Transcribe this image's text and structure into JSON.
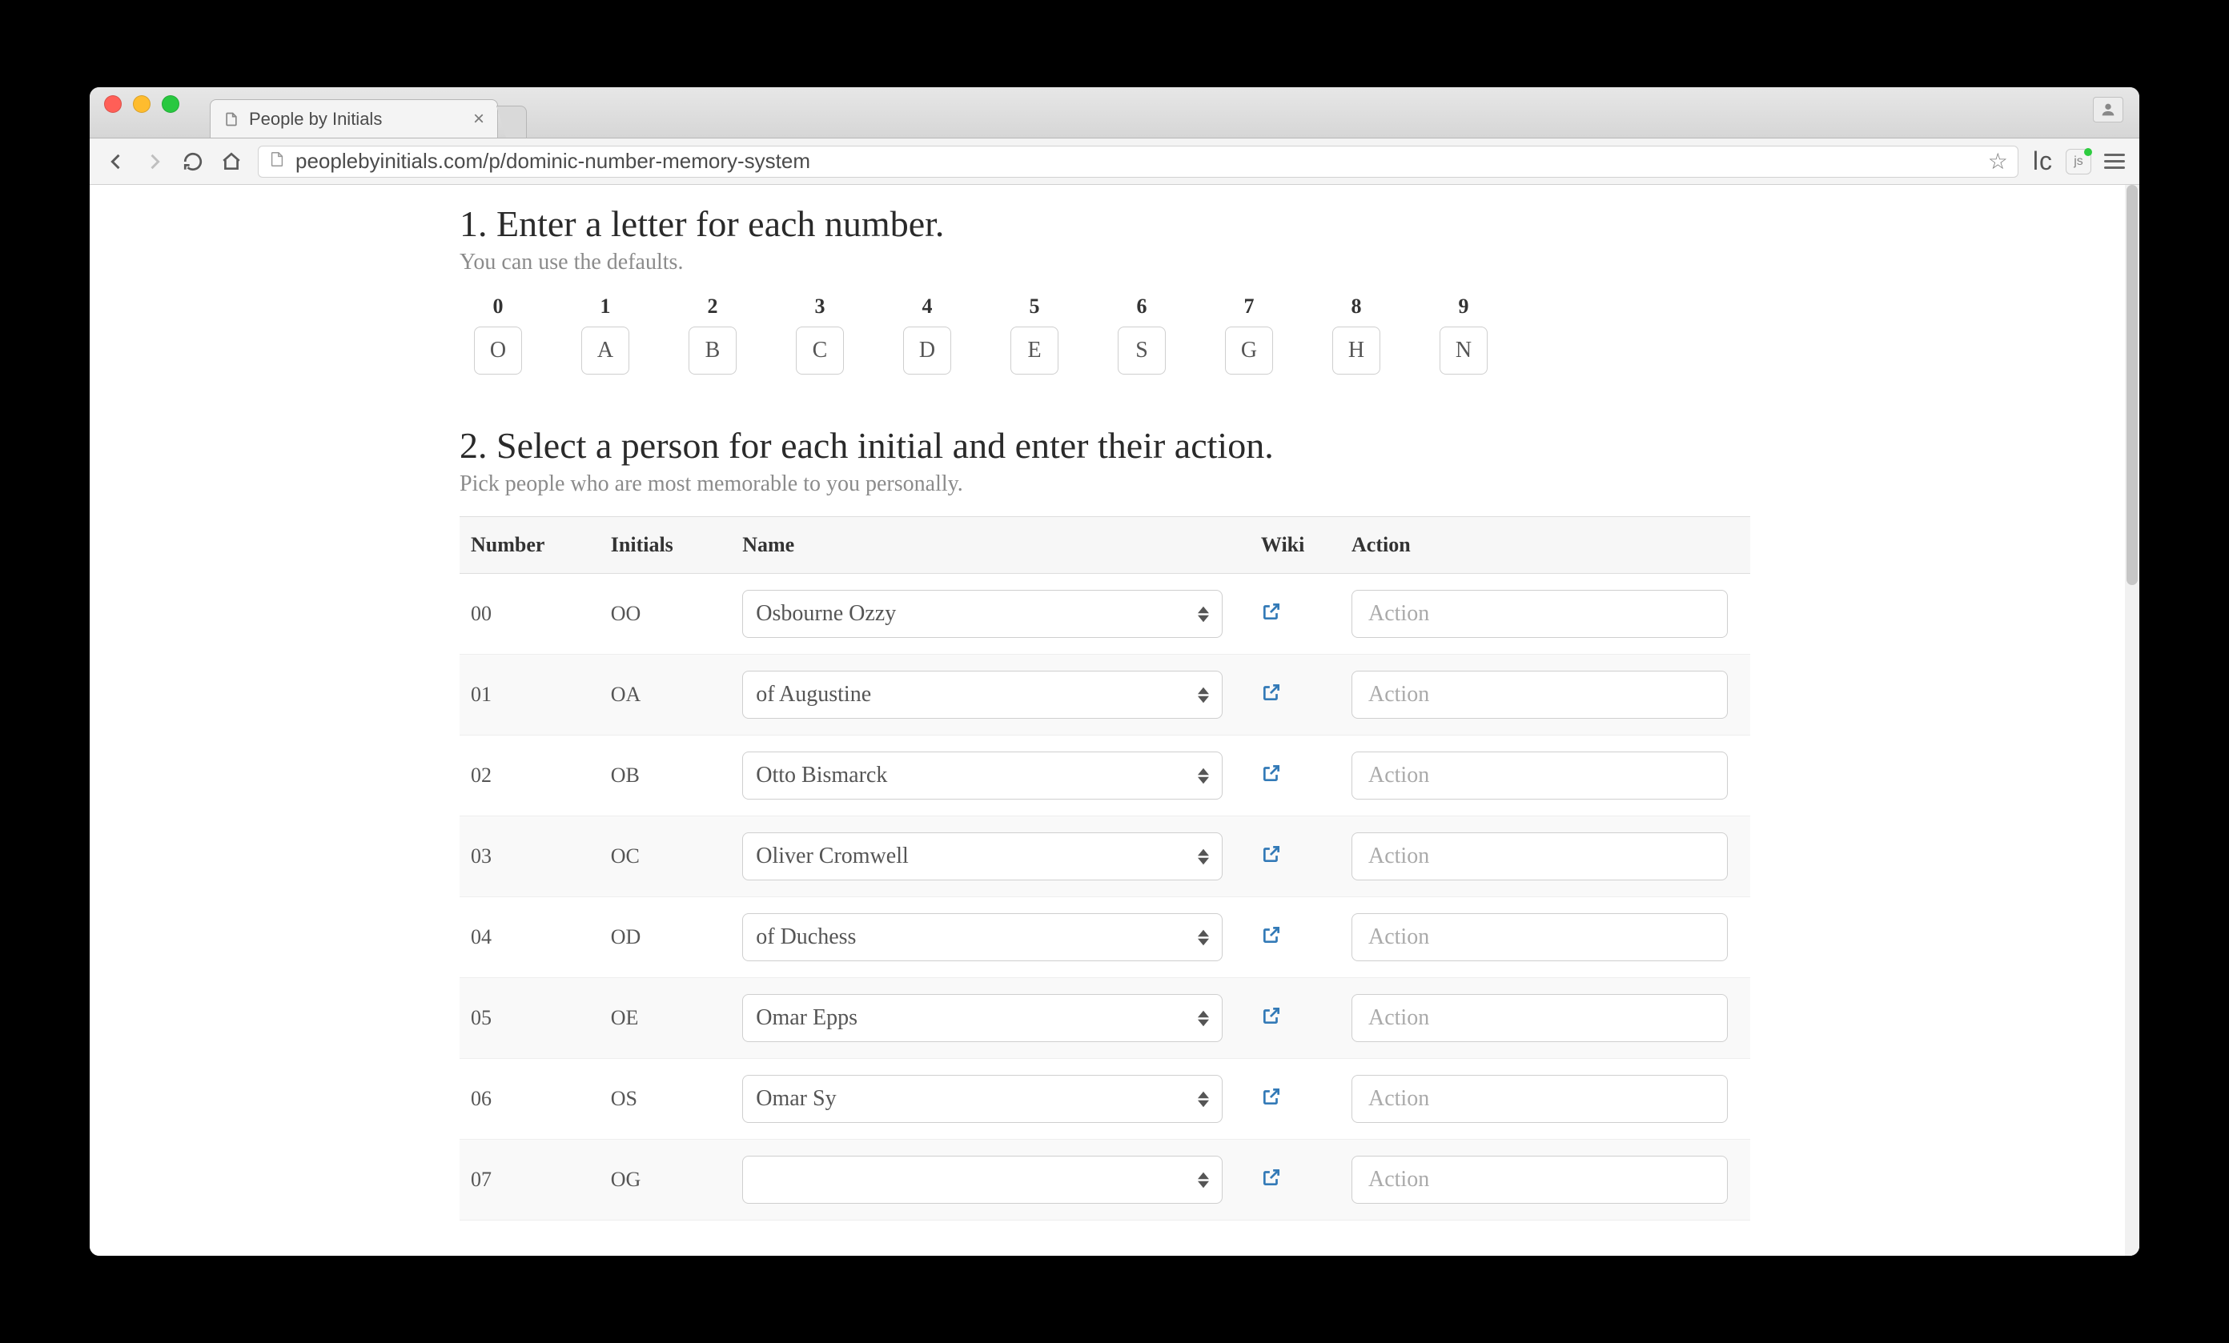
{
  "browser": {
    "tab_title": "People by Initials",
    "url": "peoplebyinitials.com/p/dominic-number-memory-system"
  },
  "step1": {
    "title": "1. Enter a letter for each number.",
    "subtitle": "You can use the defaults.",
    "map": [
      {
        "n": "0",
        "l": "O"
      },
      {
        "n": "1",
        "l": "A"
      },
      {
        "n": "2",
        "l": "B"
      },
      {
        "n": "3",
        "l": "C"
      },
      {
        "n": "4",
        "l": "D"
      },
      {
        "n": "5",
        "l": "E"
      },
      {
        "n": "6",
        "l": "S"
      },
      {
        "n": "7",
        "l": "G"
      },
      {
        "n": "8",
        "l": "H"
      },
      {
        "n": "9",
        "l": "N"
      }
    ]
  },
  "step2": {
    "title": "2. Select a person for each initial and enter their action.",
    "subtitle": "Pick people who are most memorable to you personally."
  },
  "headers": {
    "number": "Number",
    "initials": "Initials",
    "name": "Name",
    "wiki": "Wiki",
    "action": "Action"
  },
  "action_placeholder": "Action",
  "rows": [
    {
      "number": "00",
      "initials": "OO",
      "name": "Osbourne Ozzy"
    },
    {
      "number": "01",
      "initials": "OA",
      "name": "of Augustine"
    },
    {
      "number": "02",
      "initials": "OB",
      "name": "Otto Bismarck"
    },
    {
      "number": "03",
      "initials": "OC",
      "name": "Oliver Cromwell"
    },
    {
      "number": "04",
      "initials": "OD",
      "name": "of Duchess"
    },
    {
      "number": "05",
      "initials": "OE",
      "name": "Omar Epps"
    },
    {
      "number": "06",
      "initials": "OS",
      "name": "Omar Sy"
    },
    {
      "number": "07",
      "initials": "OG",
      "name": ""
    }
  ]
}
